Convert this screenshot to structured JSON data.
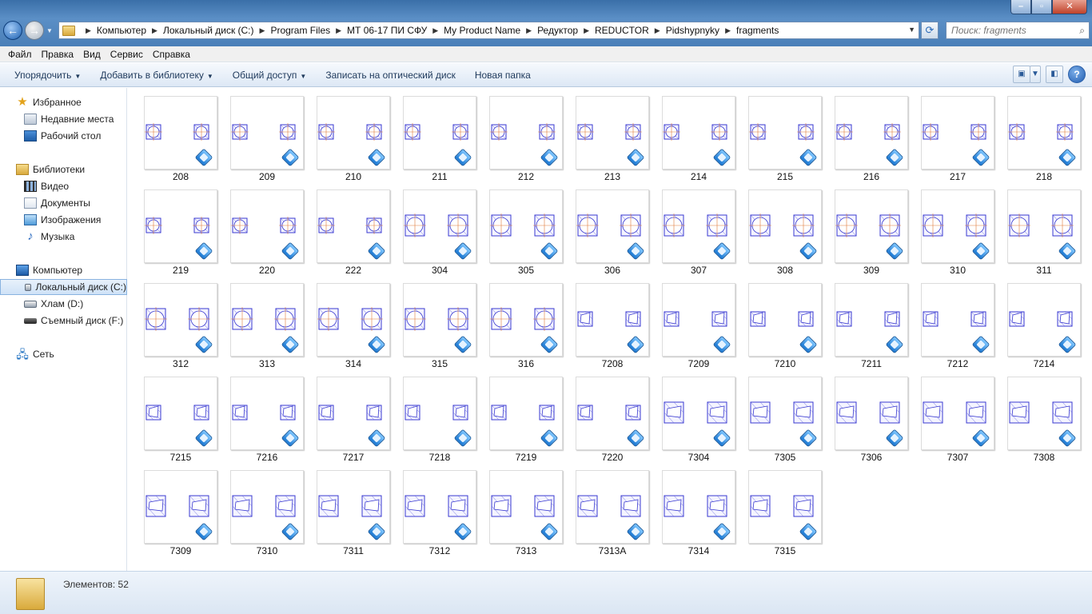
{
  "address": {
    "crumbs": [
      "Компьютер",
      "Локальный диск (C:)",
      "Program Files",
      "МТ 06-17 ПИ СФУ",
      "My Product Name",
      "Редуктор",
      "REDUCTOR",
      "Pidshypnyky",
      "fragments"
    ]
  },
  "search": {
    "placeholder": "Поиск: fragments"
  },
  "menu": [
    "Файл",
    "Правка",
    "Вид",
    "Сервис",
    "Справка"
  ],
  "toolbar": {
    "organize": "Упорядочить",
    "add_library": "Добавить в библиотеку",
    "share": "Общий доступ",
    "burn": "Записать на оптический диск",
    "new_folder": "Новая папка"
  },
  "nav": {
    "favorites": "Избранное",
    "recent": "Недавние места",
    "desktop": "Рабочий стол",
    "libraries": "Библиотеки",
    "video": "Видео",
    "documents": "Документы",
    "images": "Изображения",
    "music": "Музыка",
    "computer": "Компьютер",
    "local_disk": "Локальный диск (C:)",
    "junk_disk": "Хлам (D:)",
    "removable": "Съемный диск (F:)",
    "network": "Сеть"
  },
  "files": [
    "208",
    "209",
    "210",
    "211",
    "212",
    "213",
    "214",
    "215",
    "216",
    "217",
    "218",
    "219",
    "220",
    "222",
    "304",
    "305",
    "306",
    "307",
    "308",
    "309",
    "310",
    "311",
    "312",
    "313",
    "314",
    "315",
    "316",
    "7208",
    "7209",
    "7210",
    "7211",
    "7212",
    "7214",
    "7215",
    "7216",
    "7217",
    "7218",
    "7219",
    "7220",
    "7304",
    "7305",
    "7306",
    "7307",
    "7308",
    "7309",
    "7310",
    "7311",
    "7312",
    "7313",
    "7313А",
    "7314",
    "7315"
  ],
  "status": {
    "items_count": "Элементов: 52"
  },
  "colors": {
    "drawing_line": "#3a3ad0",
    "hatch": "#6a6ae0",
    "axis": "#e07a3a"
  }
}
